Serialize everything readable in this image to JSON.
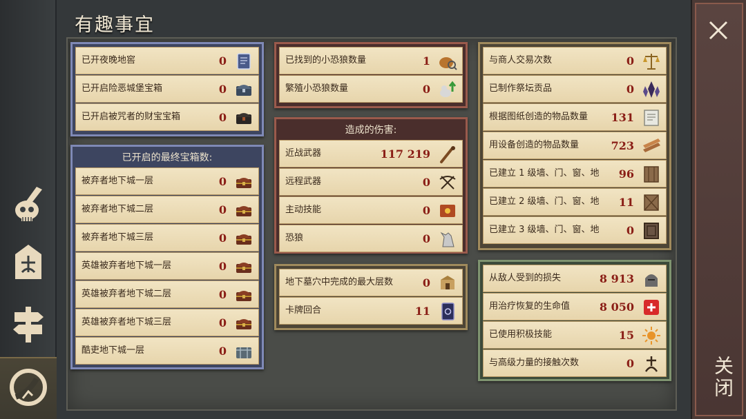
{
  "page_title": "有趣事宜",
  "close_label": "关闭",
  "nav": [
    {
      "icon": "skull-dagger-icon"
    },
    {
      "icon": "shrine-icon"
    },
    {
      "icon": "signpost-icon"
    },
    {
      "icon": "crescent-icon"
    }
  ],
  "p1": {
    "rows": [
      {
        "label": "已开夜晚地窖",
        "value": "0",
        "icon": "tome-icon"
      },
      {
        "label": "已开启险恶城堡宝箱",
        "value": "0",
        "icon": "chest-icon"
      },
      {
        "label": "已开启被咒者的财宝宝箱",
        "value": "0",
        "icon": "cursed-chest-icon"
      }
    ]
  },
  "p2": {
    "title": "已开启的最终宝箱数:",
    "rows": [
      {
        "label": "被弃者地下城一层",
        "value": "0",
        "icon": "treasure-chest-icon"
      },
      {
        "label": "被弃者地下城二层",
        "value": "0",
        "icon": "treasure-chest-icon"
      },
      {
        "label": "被弃者地下城三层",
        "value": "0",
        "icon": "treasure-chest-icon"
      },
      {
        "label": "英雄被弃者地下城一层",
        "value": "0",
        "icon": "treasure-chest-icon"
      },
      {
        "label": "英雄被弃者地下城二层",
        "value": "0",
        "icon": "treasure-chest-icon"
      },
      {
        "label": "英雄被弃者地下城三层",
        "value": "0",
        "icon": "treasure-chest-icon"
      },
      {
        "label": "酷吏地下城一层",
        "value": "0",
        "icon": "iron-chest-icon"
      }
    ]
  },
  "p3": {
    "rows": [
      {
        "label": "已找到的小恐狼数量",
        "value": "1",
        "icon": "search-basket-icon"
      },
      {
        "label": "繁殖小恐狼数量",
        "value": "0",
        "icon": "wolf-pup-up-icon"
      }
    ]
  },
  "p4": {
    "title": "造成的伤害:",
    "rows": [
      {
        "label": "近战武器",
        "value": "117 219",
        "icon": "club-icon"
      },
      {
        "label": "远程武器",
        "value": "0",
        "icon": "crossbow-icon"
      },
      {
        "label": "主动技能",
        "value": "0",
        "icon": "spellbook-icon"
      },
      {
        "label": "恐狼",
        "value": "0",
        "icon": "wolf-icon"
      }
    ]
  },
  "p5": {
    "rows": [
      {
        "label": "地下墓穴中完成的最大层数",
        "value": "0",
        "icon": "catacomb-icon"
      },
      {
        "label": "卡牌回合",
        "value": "11",
        "icon": "card-icon"
      }
    ]
  },
  "p6": {
    "rows": [
      {
        "label": "与商人交易次数",
        "value": "0",
        "icon": "scales-icon"
      },
      {
        "label": "已制作祭坛贡品",
        "value": "0",
        "icon": "crystal-icon"
      },
      {
        "label": "根据图纸创造的物品数量",
        "value": "131",
        "icon": "blueprint-icon"
      },
      {
        "label": "用设备创造的物品数量",
        "value": "723",
        "icon": "planks-icon"
      },
      {
        "label": "已建立 1 级墙、门、窗、地",
        "value": "96",
        "icon": "wall-1-icon"
      },
      {
        "label": "已建立 2 级墙、门、窗、地",
        "value": "11",
        "icon": "wall-2-icon"
      },
      {
        "label": "已建立 3 级墙、门、窗、地",
        "value": "0",
        "icon": "wall-3-icon"
      }
    ]
  },
  "p7": {
    "rows": [
      {
        "label": "从敌人受到的损失",
        "value": "8 913",
        "icon": "helmet-icon"
      },
      {
        "label": "用治疗恢复的生命值",
        "value": "8 050",
        "icon": "health-cross-icon"
      },
      {
        "label": "已使用积极技能",
        "value": "15",
        "icon": "sun-icon"
      },
      {
        "label": "与高级力量的接触次数",
        "value": "0",
        "icon": "rune-icon"
      }
    ]
  },
  "colors": {
    "value_red": "#8a1e16",
    "row_bg": "#f1e4c3",
    "blue_border": "#7f89b6",
    "red_border": "#9a5a4c",
    "tan_border": "#a08a5c",
    "green_border": "#7f9470"
  }
}
